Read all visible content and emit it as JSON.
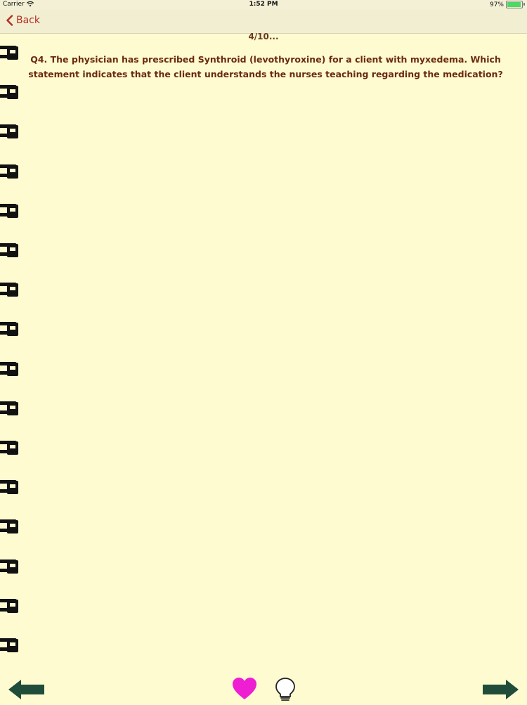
{
  "status_bar": {
    "carrier": "Carrier",
    "time": "1:52 PM",
    "battery": "97%",
    "battery_level": 0.97
  },
  "nav": {
    "back_label": "Back"
  },
  "quiz": {
    "progress": "4/10...",
    "question": "Q4. The physician has prescribed Synthroid (levothyroxine) for a client with myxedema. Which statement indicates that the client understands the nurses teaching regarding the medication?"
  },
  "colors": {
    "background": "#fefbd1",
    "text": "#6b2a0e",
    "back_link": "#b22f25",
    "arrows": "#1f4d3a",
    "heart": "#ee1ed2"
  },
  "icons": {
    "back": "chevron-left-icon",
    "previous": "arrow-left-icon",
    "favorite": "heart-icon",
    "hint": "lightbulb-icon",
    "next": "arrow-right-icon"
  }
}
